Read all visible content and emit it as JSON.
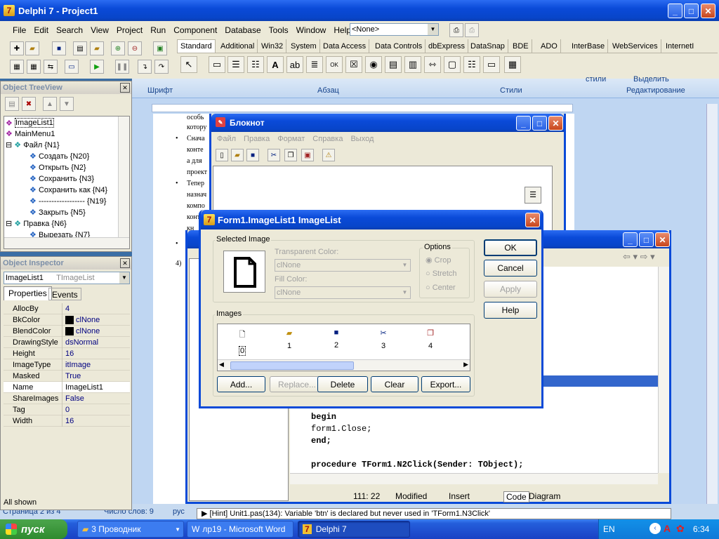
{
  "delphi": {
    "title": "Delphi 7 - Project1",
    "menu": [
      "File",
      "Edit",
      "Search",
      "View",
      "Project",
      "Run",
      "Component",
      "Database",
      "Tools",
      "Window",
      "Help"
    ],
    "combo": "<None>",
    "palette_tabs": [
      "Standard",
      "Additional",
      "Win32",
      "System",
      "Data Access",
      "Data Controls",
      "dbExpress",
      "DataSnap",
      "BDE",
      "ADO",
      "InterBase",
      "WebServices",
      "InternetI"
    ]
  },
  "word": {
    "ribbon_groups": [
      "Шрифт",
      "Абзац",
      "Стили",
      "Редактирование"
    ],
    "styles_partial": "стили",
    "edit_partial": "Выделить",
    "page_frags": [
      "особь",
      "котору",
      "Снача",
      "конте",
      "а для",
      "проект",
      "Тепер",
      "назнач",
      "компо",
      "конте",
      "кн"
    ],
    "status_left": "Страница 2 из 4",
    "status_mid": "Число слов: 9",
    "status_lang": "рус"
  },
  "notepad": {
    "title": "Блокнот",
    "menu": [
      "Файл",
      "Правка",
      "Формат",
      "Справка",
      "Выход"
    ]
  },
  "treeview": {
    "title": "Object TreeView",
    "items": [
      "ImageList1",
      "MainMenu1",
      "Файл {N1}",
      "Создать {N20}",
      "Открыть {N2}",
      "Сохранить {N3}",
      "Сохранить как {N4}",
      "------------------ {N19}",
      "Закрыть {N5}",
      "Правка {N6}",
      "Вырезать {N7}"
    ]
  },
  "inspector": {
    "title": "Object Inspector",
    "object": "ImageList1",
    "type": "TImageList",
    "tabs": [
      "Properties",
      "Events"
    ],
    "props": [
      [
        "AllocBy",
        "4"
      ],
      [
        "BkColor",
        "clNone"
      ],
      [
        "BlendColor",
        "clNone"
      ],
      [
        "DrawingStyle",
        "dsNormal"
      ],
      [
        "Height",
        "16"
      ],
      [
        "ImageType",
        "itImage"
      ],
      [
        "Masked",
        "True"
      ],
      [
        "Name",
        "ImageList1"
      ],
      [
        "ShareImages",
        "False"
      ],
      [
        "Tag",
        "0"
      ],
      [
        "Width",
        "16"
      ]
    ],
    "status": "All shown"
  },
  "editor": {
    "code": [
      "begin",
      "form1.Close;",
      "end;",
      "procedure TForm1.N2Click(Sender: TObject);"
    ],
    "pos": "111:  22",
    "state": "Modified",
    "mode": "Insert",
    "tabs": [
      "Code",
      "Diagram"
    ],
    "hint": "[Hint] Unit1.pas(134): Variable 'btn' is declared but never used in 'TForm1.N3Click'"
  },
  "dialog": {
    "title": "Form1.ImageList1 ImageList",
    "selected_label": "Selected Image",
    "transparent_label": "Transparent Color:",
    "transparent_value": "clNone",
    "fill_label": "Fill Color:",
    "fill_value": "clNone",
    "options_label": "Options",
    "options": [
      "Crop",
      "Stretch",
      "Center"
    ],
    "images_label": "Images",
    "image_indexes": [
      "0",
      "1",
      "2",
      "3",
      "4"
    ],
    "buttons": {
      "ok": "OK",
      "cancel": "Cancel",
      "apply": "Apply",
      "help": "Help",
      "add": "Add...",
      "replace": "Replace...",
      "delete": "Delete",
      "clear": "Clear",
      "export": "Export..."
    }
  },
  "taskbar": {
    "start": "пуск",
    "items": [
      "3 Проводник",
      "лр19 - Microsoft Word",
      "Delphi 7"
    ],
    "lang": "EN",
    "time": "6:34"
  }
}
